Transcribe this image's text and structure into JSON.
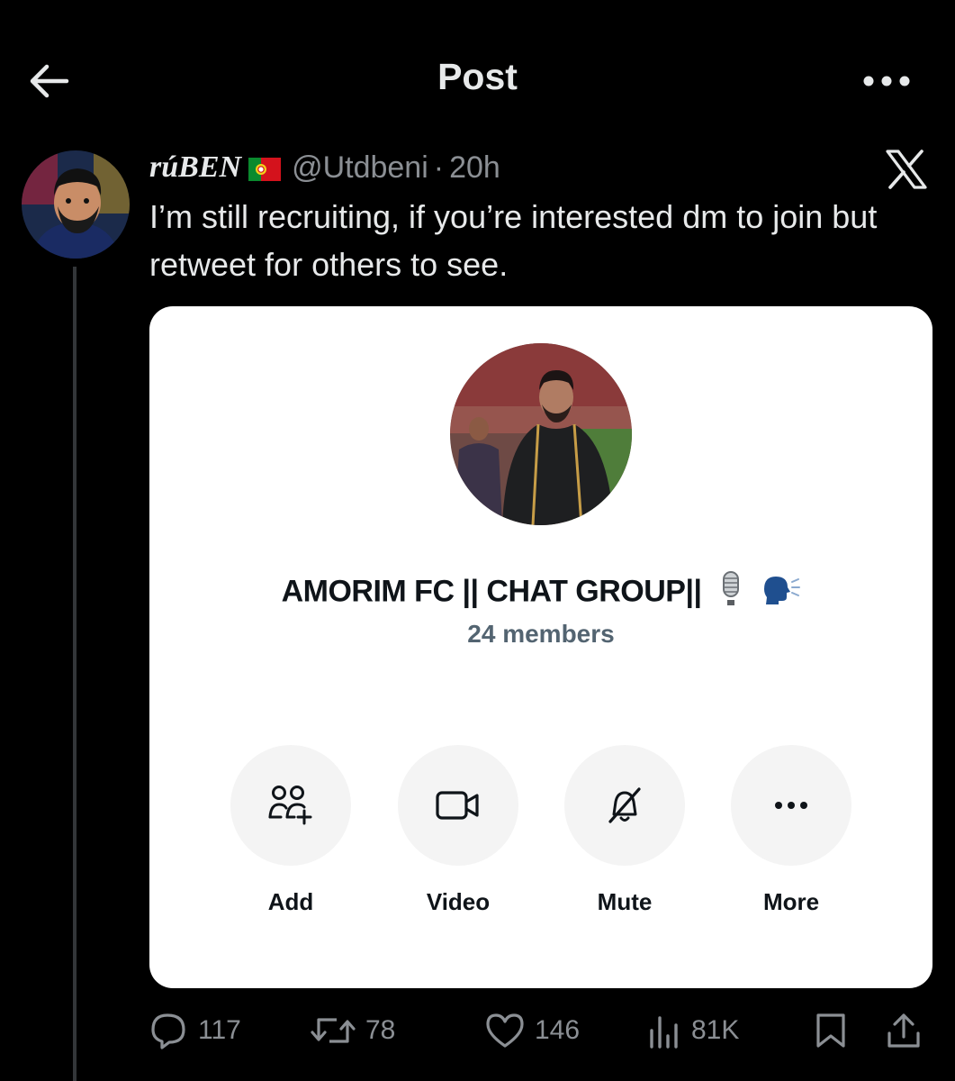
{
  "header": {
    "title": "Post",
    "back_icon": "arrow-left-icon",
    "menu_icon": "more-horizontal-icon"
  },
  "tweet": {
    "display_name": "rúBEN",
    "flag_icon": "portugal-flag-icon",
    "handle": "@Utdbeni",
    "separator": "·",
    "time": "20h",
    "platform_icon": "x-logo-icon",
    "text": "I’m still recruiting, if you’re interested dm to join but retweet for others to see."
  },
  "card": {
    "group_name": "AMORIM FC || CHAT GROUP||",
    "group_emojis": [
      "microphone-icon",
      "speaking-head-icon"
    ],
    "members": "24 members",
    "actions": [
      {
        "label": "Add",
        "icon": "add-people-icon"
      },
      {
        "label": "Video",
        "icon": "video-camera-icon"
      },
      {
        "label": "Mute",
        "icon": "bell-muted-icon"
      },
      {
        "label": "More",
        "icon": "more-horizontal-icon"
      }
    ]
  },
  "stats": {
    "replies": "117",
    "reposts": "78",
    "likes": "146",
    "views": "81K"
  },
  "colors": {
    "background": "#000000",
    "text": "#e7e9ea",
    "muted": "#8b8f94",
    "card_bg": "#ffffff",
    "card_text": "#0f1419",
    "card_muted": "#536471"
  }
}
